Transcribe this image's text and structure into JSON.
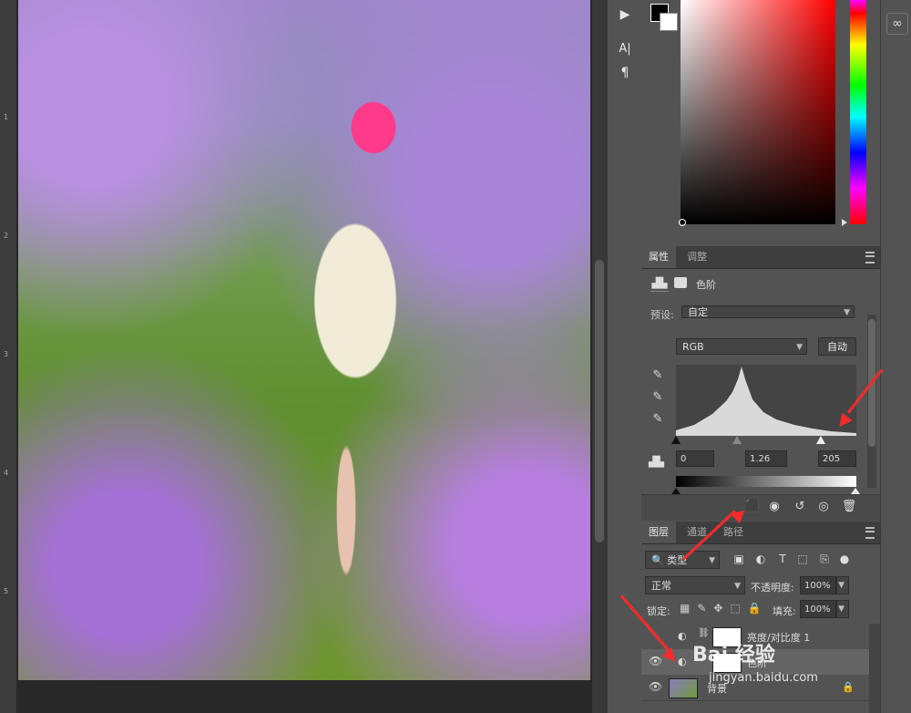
{
  "ruler": {
    "marks": [
      "1",
      "2",
      "3",
      "4",
      "5"
    ]
  },
  "tools": {
    "play": "▶",
    "text_tool": "A|",
    "paragraph": "¶"
  },
  "properties": {
    "tabs": [
      "属性",
      "调整"
    ],
    "title": "色阶",
    "preset_label": "预设:",
    "preset_value": "自定",
    "channel": "RGB",
    "auto_button": "自动",
    "input_black": "0",
    "input_gamma": "1.26",
    "input_white": "205"
  },
  "layers": {
    "tabs": [
      "图层",
      "通道",
      "路径"
    ],
    "filter_kind": "类型",
    "blend_mode": "正常",
    "opacity_label": "不透明度:",
    "opacity_value": "100%",
    "lock_label": "锁定:",
    "fill_label": "填充:",
    "fill_value": "100%",
    "rows": [
      {
        "name": "亮度/对比度 1"
      },
      {
        "name": "色阶"
      },
      {
        "name": "背景"
      }
    ]
  },
  "watermark": {
    "text": "Bai 经验",
    "url": "jingyan.baidu.com"
  },
  "colors": {
    "accent_red": "#ff2a2a",
    "panel_bg": "#535353",
    "dark_bg": "#282828"
  }
}
